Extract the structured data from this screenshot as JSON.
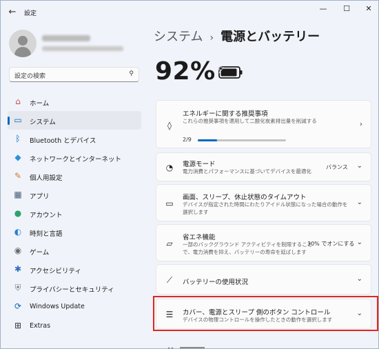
{
  "window": {
    "title": "設定",
    "controls": {
      "minimize": "—",
      "maximize": "☐",
      "close": "✕"
    }
  },
  "search": {
    "placeholder": "設定の検索"
  },
  "nav": {
    "items": [
      {
        "label": "ホーム",
        "icon": "home-icon",
        "glyph": "⌂",
        "color": "#c0504d"
      },
      {
        "label": "システム",
        "icon": "system-icon",
        "glyph": "▭",
        "color": "#0067c0"
      },
      {
        "label": "Bluetooth とデバイス",
        "icon": "bluetooth-icon",
        "glyph": "ᛒ",
        "color": "#0067c0"
      },
      {
        "label": "ネットワークとインターネット",
        "icon": "network-icon",
        "glyph": "◆",
        "color": "#2c8fd8"
      },
      {
        "label": "個人用設定",
        "icon": "personalization-icon",
        "glyph": "✎",
        "color": "#d07a2c"
      },
      {
        "label": "アプリ",
        "icon": "apps-icon",
        "glyph": "▦",
        "color": "#4a5d7a"
      },
      {
        "label": "アカウント",
        "icon": "accounts-icon",
        "glyph": "●",
        "color": "#2ea36b"
      },
      {
        "label": "時刻と言語",
        "icon": "time-language-icon",
        "glyph": "◐",
        "color": "#2c7fd8"
      },
      {
        "label": "ゲーム",
        "icon": "gaming-icon",
        "glyph": "◉",
        "color": "#6b6b6b"
      },
      {
        "label": "アクセシビリティ",
        "icon": "accessibility-icon",
        "glyph": "✱",
        "color": "#2c6fc0"
      },
      {
        "label": "プライバシーとセキュリティ",
        "icon": "privacy-shield-icon",
        "glyph": "⛨",
        "color": "#6b7380"
      },
      {
        "label": "Windows Update",
        "icon": "windows-update-icon",
        "glyph": "⟳",
        "color": "#0067c0"
      },
      {
        "label": "Extras",
        "icon": "extras-icon",
        "glyph": "⊞",
        "color": "#333333"
      }
    ],
    "selected_index": 1
  },
  "breadcrumb": {
    "parent": "システム",
    "separator": "›",
    "current": "電源とバッテリー"
  },
  "battery": {
    "percent": "92%",
    "level": 0.92
  },
  "cards": {
    "recommendations": {
      "title": "エネルギーに関する推奨事項",
      "desc": "これらの推奨事項を適用して二酸化炭素排出量を削減する",
      "progress_text": "2/9",
      "progress": 0.222
    },
    "power_mode": {
      "title": "電源モード",
      "desc": "電力消費とパフォーマンスに基づいてデバイスを最適化",
      "value": "バランス"
    },
    "screen_sleep": {
      "title": "画面、スリープ、休止状態のタイムアウト",
      "desc_line1": "デバイスが指定された時間にわたりアイドル状態になった場合の動作を",
      "desc_line2": "選択します"
    },
    "energy_saver": {
      "title": "省エネ機能",
      "desc_line1": "一部のバックグラウンド アクティビティを制限すること",
      "desc_line2": "で、電力消費を抑え、バッテリーの寿命を延ばします",
      "value": "30% でオンにする"
    },
    "battery_usage": {
      "title": "バッテリーの使用状況"
    },
    "lid_power": {
      "title": "カバー、電源とスリープ 側のボタン コントロール",
      "desc": "デバイスの物理コントロールを操作したときの動作を選択します"
    }
  },
  "colors": {
    "accent": "#0067c0",
    "highlight": "#e0261e"
  }
}
